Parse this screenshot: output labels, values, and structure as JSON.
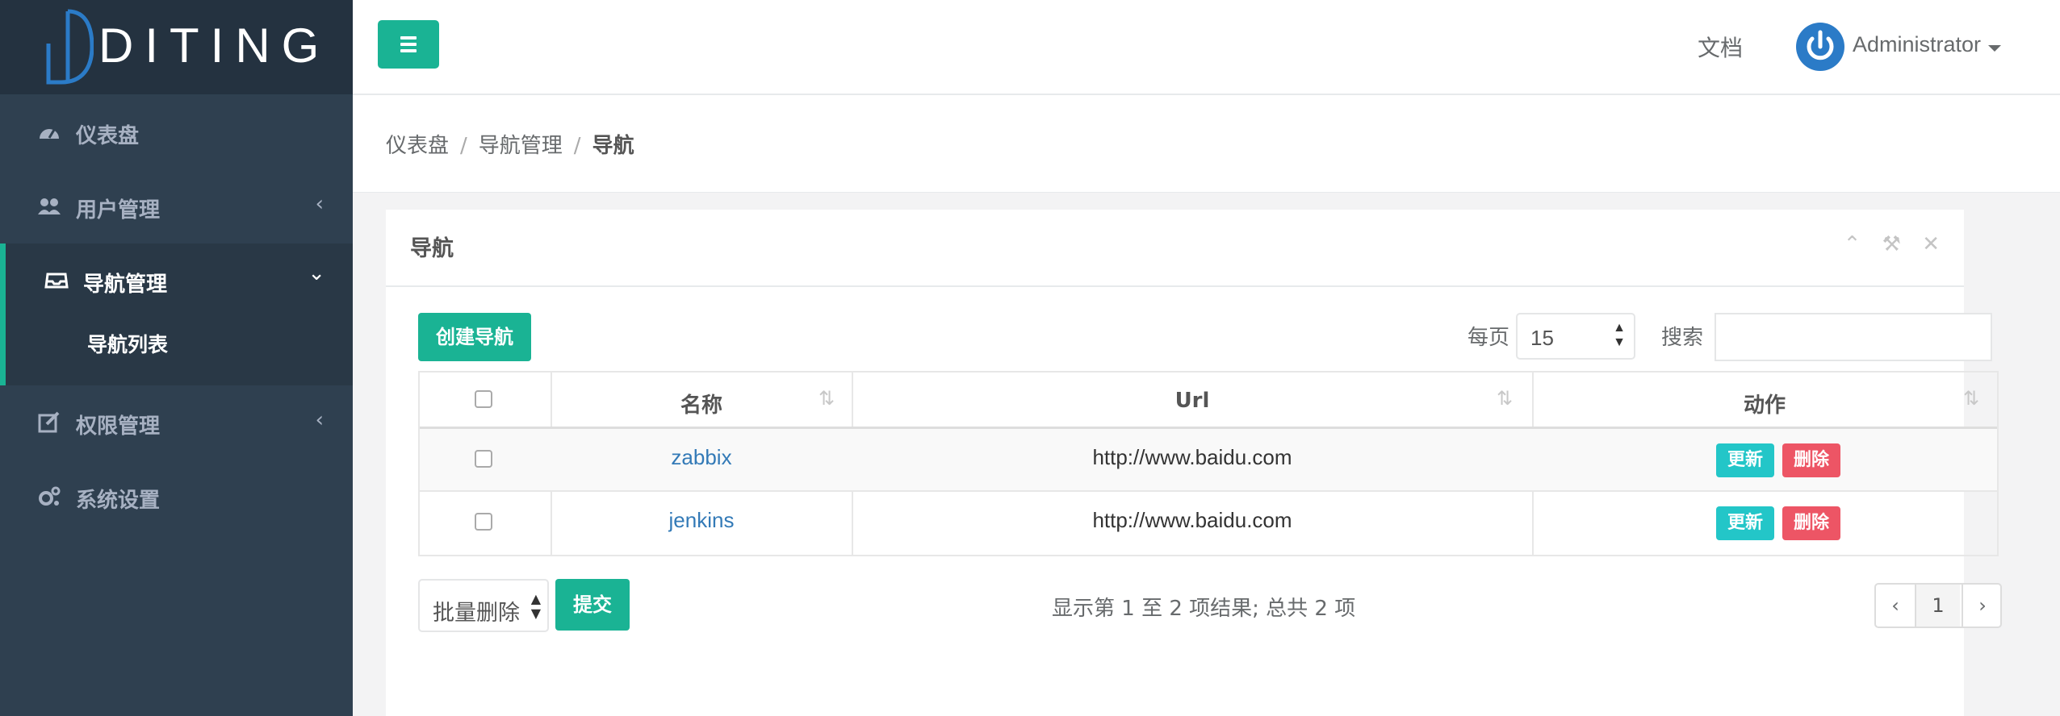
{
  "brand": {
    "logo_text": "DITING"
  },
  "sidebar": {
    "items": [
      {
        "label": "仪表盘",
        "icon": "dashboard-icon"
      },
      {
        "label": "用户管理",
        "icon": "users-icon",
        "chevron": "‹"
      },
      {
        "label": "导航管理",
        "icon": "inbox-icon",
        "chevron": "⌄",
        "active": true,
        "children": [
          {
            "label": "导航列表"
          }
        ]
      },
      {
        "label": "权限管理",
        "icon": "edit-icon",
        "chevron": "‹"
      },
      {
        "label": "系统设置",
        "icon": "cogs-icon"
      }
    ]
  },
  "topbar": {
    "docs_label": "文档",
    "user_name": "Administrator"
  },
  "breadcrumb": [
    "仪表盘",
    "导航管理",
    "导航"
  ],
  "panel": {
    "title": "导航",
    "create_label": "创建导航",
    "per_page_label": "每页",
    "per_page_value": "15",
    "search_label": "搜索",
    "search_value": ""
  },
  "table": {
    "columns": [
      "名称",
      "Url",
      "动作"
    ],
    "rows": [
      {
        "name": "zabbix",
        "url": "http://www.baidu.com",
        "update": "更新",
        "delete": "删除"
      },
      {
        "name": "jenkins",
        "url": "http://www.baidu.com",
        "update": "更新",
        "delete": "删除"
      }
    ]
  },
  "footer": {
    "bulk_action": "批量删除",
    "submit_label": "提交",
    "info": "显示第 1 至 2 项结果; 总共 2 项",
    "pager": {
      "prev": "‹",
      "page": "1",
      "next": "›"
    }
  },
  "colors": {
    "primary": "#1ab394",
    "sidebar_bg": "#2f4050",
    "update_btn": "#23c6c8",
    "delete_btn": "#ed5565",
    "link": "#337ab7"
  }
}
